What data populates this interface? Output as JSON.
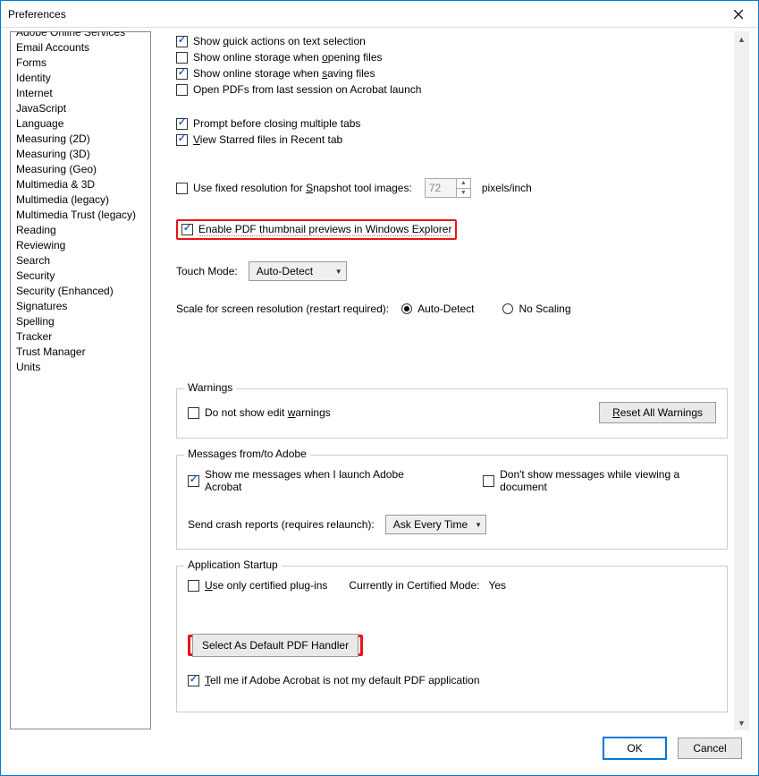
{
  "title": "Preferences",
  "sidebar": {
    "items": [
      "Adobe Online Services",
      "Email Accounts",
      "Forms",
      "Identity",
      "Internet",
      "JavaScript",
      "Language",
      "Measuring (2D)",
      "Measuring (3D)",
      "Measuring (Geo)",
      "Multimedia & 3D",
      "Multimedia (legacy)",
      "Multimedia Trust (legacy)",
      "Reading",
      "Reviewing",
      "Search",
      "Security",
      "Security (Enhanced)",
      "Signatures",
      "Spelling",
      "Tracker",
      "Trust Manager",
      "Units"
    ]
  },
  "opts": {
    "quick_actions": "Show quick actions on text selection",
    "open_storage": "Show online storage when opening files",
    "save_storage": "Show online storage when saving files",
    "open_last": "Open PDFs from last session on Acrobat launch",
    "prompt_close": "Prompt before closing multiple tabs",
    "view_starred": "View Starred files in Recent tab",
    "snapshot_label": "Use fixed resolution for Snapshot tool images:",
    "snapshot_value": "72",
    "snapshot_units": "pixels/inch",
    "thumb_previews": "Enable PDF thumbnail previews in Windows Explorer",
    "touch_mode_label": "Touch Mode:",
    "touch_mode_value": "Auto-Detect",
    "scale_label": "Scale for screen resolution (restart required):",
    "scale_auto": "Auto-Detect",
    "scale_none": "No Scaling"
  },
  "warnings": {
    "legend": "Warnings",
    "dont_show": "Do not show edit warnings",
    "reset_btn": "Reset All Warnings"
  },
  "messages": {
    "legend": "Messages from/to Adobe",
    "show_launch": "Show me messages when I launch Adobe Acrobat",
    "dont_viewing": "Don't show messages while viewing a document",
    "crash_label": "Send crash reports (requires relaunch):",
    "crash_value": "Ask Every Time"
  },
  "startup": {
    "legend": "Application Startup",
    "certified": "Use only certified plug-ins",
    "cert_mode_label": "Currently in Certified Mode:",
    "cert_mode_value": "Yes",
    "default_handler_btn": "Select As Default PDF Handler",
    "tell_default": "Tell me if Adobe Acrobat is not my default PDF application"
  },
  "footer": {
    "ok": "OK",
    "cancel": "Cancel"
  }
}
